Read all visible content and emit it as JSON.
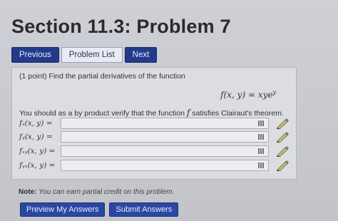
{
  "page": {
    "title": "Section 11.3: Problem 7"
  },
  "nav": {
    "previous": "Previous",
    "problem_list": "Problem List",
    "next": "Next"
  },
  "problem": {
    "intro": "(1 point) Find the partial derivatives of the function",
    "function_lhs": "f(x, y) = xye",
    "function_exp": "y",
    "verify_pre": "You should as a by product verify that the function ",
    "verify_var": "f",
    "verify_post": " satisfies Clairaut's theorem.",
    "answers": [
      {
        "label": "fₓ(x, y) =",
        "value": ""
      },
      {
        "label": "fᵧ(x, y) =",
        "value": ""
      },
      {
        "label": "fₓᵧ(x, y) =",
        "value": ""
      },
      {
        "label": "fᵧₓ(x, y) =",
        "value": ""
      }
    ]
  },
  "note": {
    "prefix": "Note:",
    "text": " You can earn partial credit on this problem."
  },
  "actions": {
    "preview": "Preview My Answers",
    "submit": "Submit Answers"
  },
  "icons": {
    "field_icon": "grid-icon",
    "edit_icon": "pencil-icon"
  }
}
